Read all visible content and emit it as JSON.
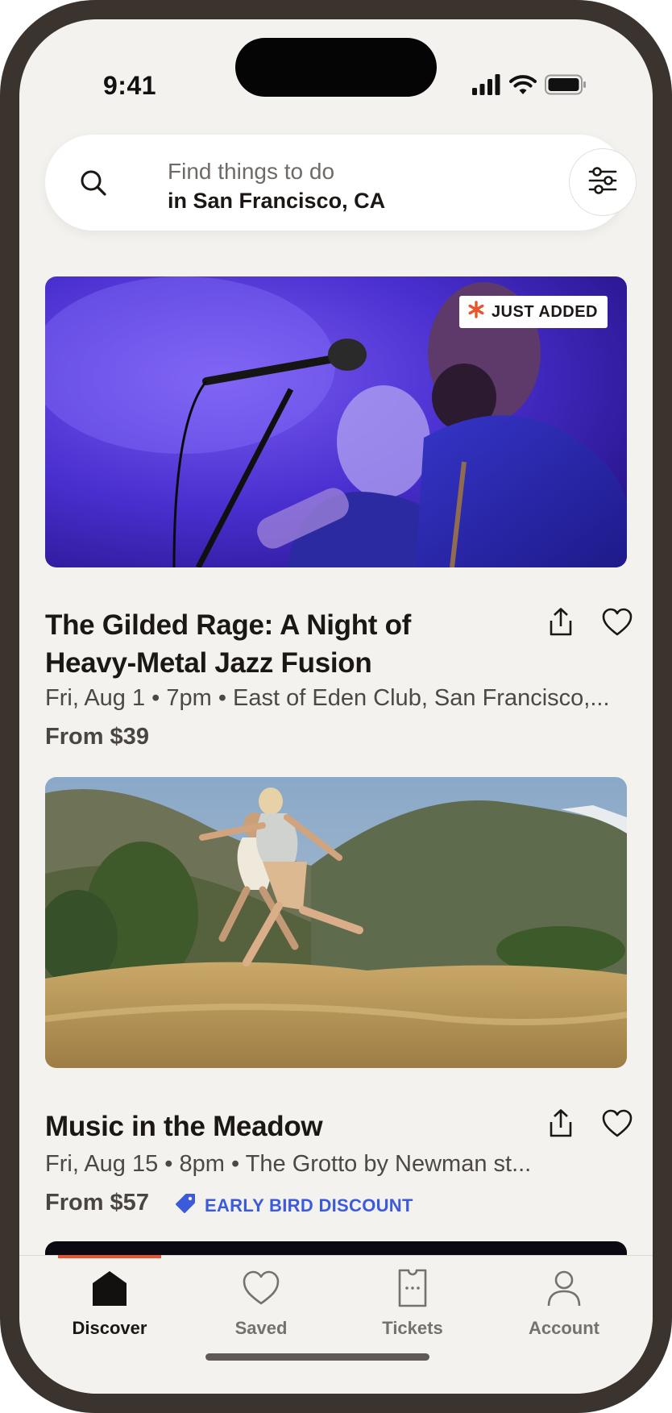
{
  "status_bar": {
    "time": "9:41"
  },
  "search": {
    "prompt": "Find things to do",
    "location": "in San Francisco, CA"
  },
  "events": [
    {
      "badge": "JUST ADDED",
      "title_line1": "The Gilded Rage: A Night of",
      "title_line2": "Heavy-Metal Jazz Fusion",
      "meta": "Fri, Aug 1 • 7pm • East of Eden Club, San Francisco,...",
      "price": "From $39"
    },
    {
      "title": "Music in the Meadow",
      "meta": "Fri, Aug 15 • 8pm • The Grotto by Newman st...",
      "price": "From $57",
      "discount": "EARLY BIRD DISCOUNT"
    }
  ],
  "tabs": [
    {
      "label": "Discover",
      "icon": "home-icon",
      "active": true
    },
    {
      "label": "Saved",
      "icon": "heart-icon",
      "active": false
    },
    {
      "label": "Tickets",
      "icon": "ticket-icon",
      "active": false
    },
    {
      "label": "Account",
      "icon": "person-icon",
      "active": false
    }
  ],
  "colors": {
    "accent": "#e8552c",
    "discount": "#3b5bdb",
    "background": "#f3f2ee",
    "frame": "#3a332e"
  }
}
